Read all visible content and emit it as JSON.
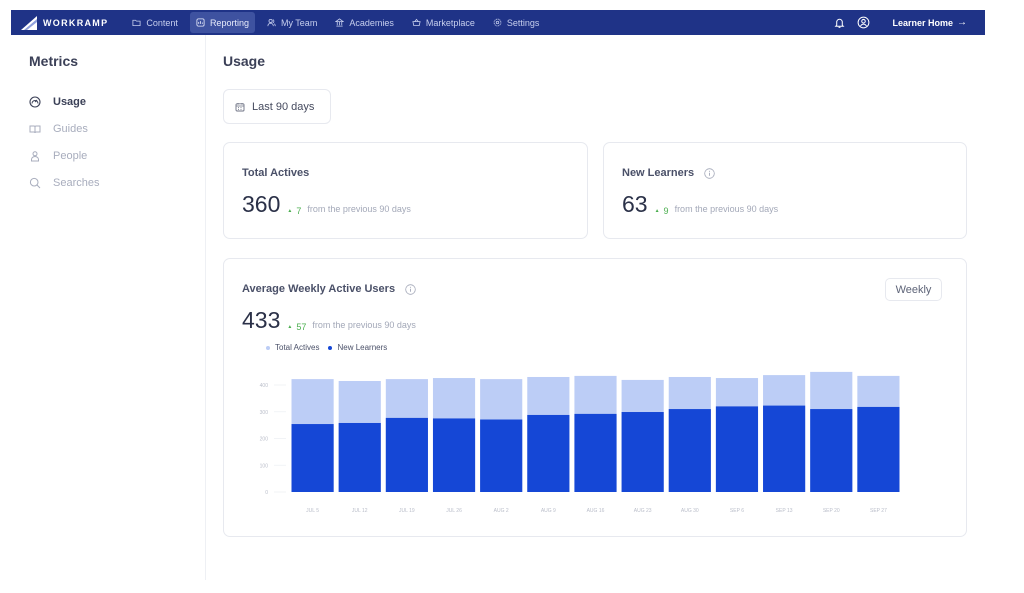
{
  "topnav": {
    "brand": "WORKRAMP",
    "items": [
      {
        "label": "Content",
        "icon": "folder-icon",
        "active": false
      },
      {
        "label": "Reporting",
        "icon": "report-icon",
        "active": true
      },
      {
        "label": "My Team",
        "icon": "team-icon",
        "active": false
      },
      {
        "label": "Academies",
        "icon": "academy-icon",
        "active": false
      },
      {
        "label": "Marketplace",
        "icon": "marketplace-icon",
        "active": false
      },
      {
        "label": "Settings",
        "icon": "gear-icon",
        "active": false
      }
    ],
    "learner_home": "Learner Home",
    "learner_home_arrow": "→",
    "colors": {
      "bar": "#1f3387",
      "active_item": "#3e52a0"
    }
  },
  "sidebar": {
    "title": "Metrics",
    "items": [
      {
        "label": "Usage",
        "icon": "gauge-icon",
        "active": true
      },
      {
        "label": "Guides",
        "icon": "book-icon",
        "active": false
      },
      {
        "label": "People",
        "icon": "person-icon",
        "active": false
      },
      {
        "label": "Searches",
        "icon": "search-icon",
        "active": false
      }
    ]
  },
  "main": {
    "title": "Usage",
    "date_range": "Last 90 days",
    "cards": {
      "total_actives": {
        "title": "Total Actives",
        "value": "360",
        "delta": "7",
        "delta_text": "from the previous 90 days"
      },
      "new_learners": {
        "title": "New Learners",
        "value": "63",
        "delta": "9",
        "delta_text": "from the previous 90 days"
      },
      "weekly_active": {
        "title": "Average Weekly Active Users",
        "value": "433",
        "delta": "57",
        "delta_text": "from the previous 90 days",
        "interval_button": "Weekly"
      }
    },
    "delta_up_glyph": "▲"
  },
  "chart_data": {
    "type": "bar",
    "stacked": "overlay",
    "title": "Average Weekly Active Users",
    "categories": [
      "JUL 5",
      "JUL 12",
      "JUL 19",
      "JUL 26",
      "AUG 2",
      "AUG 9",
      "AUG 16",
      "AUG 23",
      "AUG 30",
      "SEP 6",
      "SEP 13",
      "SEP 20",
      "SEP 27"
    ],
    "series": [
      {
        "name": "Total Actives",
        "color": "#bccdf6",
        "values": [
          422,
          415,
          422,
          426,
          422,
          430,
          434,
          419,
          430,
          426,
          437,
          449,
          434
        ]
      },
      {
        "name": "New Learners",
        "color": "#1547d6",
        "values": [
          254,
          258,
          277,
          275,
          271,
          288,
          292,
          299,
          310,
          320,
          323,
          310,
          318
        ]
      }
    ],
    "yticks": [
      0,
      100,
      200,
      300,
      400
    ],
    "ylim": [
      0,
      400
    ],
    "xlabel": "",
    "ylabel": "",
    "grid": false,
    "legend": "top-left"
  }
}
